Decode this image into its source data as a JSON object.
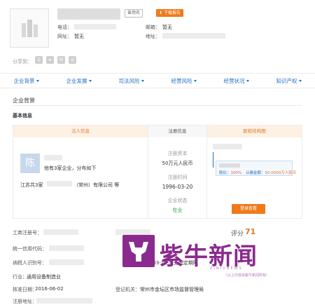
{
  "header": {
    "tag_label": "曾用名",
    "download_label": "下载报告",
    "phone_label": "电话：",
    "email_label": "邮箱：",
    "email_value": "暂无",
    "website_label": "网址：",
    "website_value": "暂无",
    "address_label": "地址："
  },
  "share": {
    "label": "分享到："
  },
  "nav": {
    "items": [
      "企业背景",
      "企业发展",
      "司法风险",
      "经营风险",
      "经营状况",
      "知识产权"
    ]
  },
  "section": {
    "title": "企业背景",
    "subtitle": "基本信息"
  },
  "legal": {
    "header": "法人信息",
    "avatar_char": "陈",
    "company_count": "他有3家企业，分布如下",
    "province": "江苏",
    "province_count": "共3家",
    "company_suffix": "（常州）有限公司 等"
  },
  "reg": {
    "header": "注册信息",
    "capital_label": "注册资本",
    "capital_value": "50万元人民币",
    "date_label": "注册时间",
    "date_value": "1996-03-20",
    "status_label": "企业状态",
    "status_value": "在业"
  },
  "equity": {
    "header": "股权结构图",
    "ratio_label": "股比：",
    "ratio_value": "100%",
    "amount_label": "认缴金额：",
    "amount_value": "50.0000万人民币",
    "button_label": "登录查看"
  },
  "details": {
    "reg_no_label": "工商注册号：",
    "credit_code_label": "统一信用代码：",
    "taxpayer_label": "纳税人识别号：",
    "industry_label": "行业：",
    "industry_value": "通用设备制造业",
    "approve_label": "核准日期：",
    "approve_value": "2016-06-02",
    "reg_addr_label": "注册地址：",
    "term_value": "1996-03-20 至无固定期限",
    "authority_label": "登记机关：",
    "authority_value": "常州市金坛区市场监督管理局",
    "score_label": "评分",
    "score_value": "71"
  },
  "watermark": {
    "text": "紫牛新闻",
    "pinyin": "ZINIUNEWS",
    "slogan": "（以上内容由紫牛新闻所有）"
  },
  "colors": {
    "accent_blue": "#1e6fbf",
    "accent_orange": "#f07a1a",
    "watermark_purple": "#8a2a8e"
  }
}
